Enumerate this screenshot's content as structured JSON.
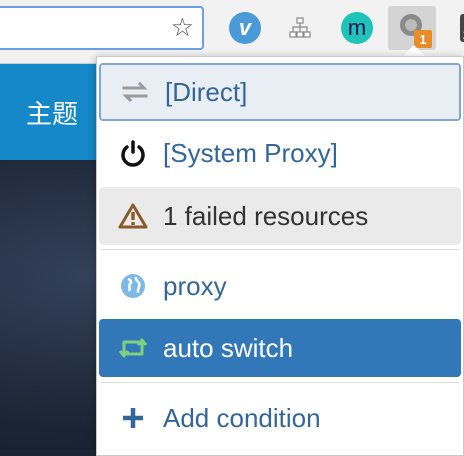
{
  "toolbar": {
    "star_icon": "star",
    "extensions": [
      {
        "name": "v-extension",
        "letter": "v",
        "color": "#4a9ad8"
      },
      {
        "name": "sitemap-extension",
        "icon": "sitemap"
      },
      {
        "name": "m-extension",
        "letter": "m",
        "color": "#1fc3b7"
      },
      {
        "name": "proxy-extension",
        "badge": "1",
        "badge_color": "#e88c2a"
      }
    ]
  },
  "page": {
    "header_label": "主题",
    "header_color": "#1488c8"
  },
  "menu": {
    "items": [
      {
        "label": "[Direct]",
        "icon": "exchange-arrows-icon"
      },
      {
        "label": "[System Proxy]",
        "icon": "power-icon"
      },
      {
        "label": "1 failed resources",
        "icon": "warning-icon"
      },
      {
        "label": "proxy",
        "icon": "globe-icon"
      },
      {
        "label": "auto switch",
        "icon": "retweet-icon",
        "selected": true
      },
      {
        "label": "Add condition",
        "icon": "plus-icon"
      }
    ],
    "accent": "#3278b8",
    "text_color": "#336699"
  }
}
